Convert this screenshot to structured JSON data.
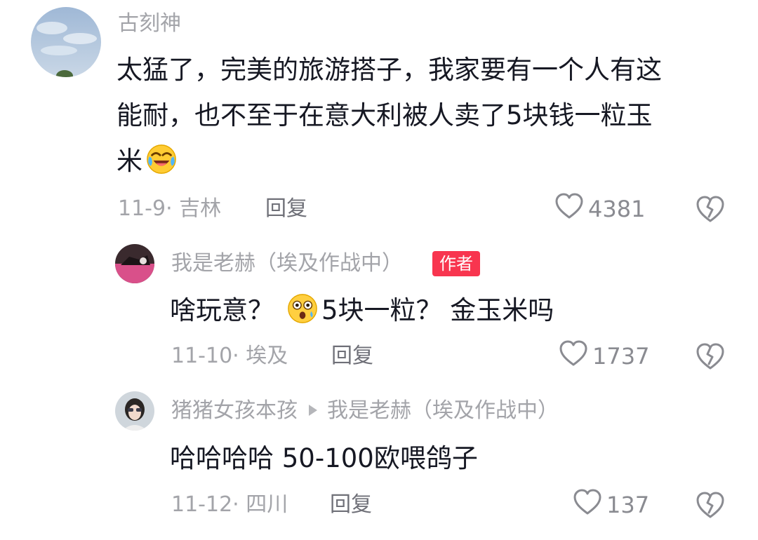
{
  "comments": [
    {
      "username": "古刻神",
      "text_line1": "太猛了，完美的旅游搭子，我家要有一个人有这",
      "text_line2": "能耐，也不至于在意大利被人卖了5块钱一粒玉",
      "text_line3": "米",
      "emoji": "laugh-cry-emoji",
      "date_location": "11-9· 吉林",
      "reply_label": "回复",
      "likes": "4381"
    },
    {
      "username": "我是老赫（埃及作战中）",
      "badge": "作者",
      "text_before_emoji": "啥玩意？",
      "emoji": "shocked-face-emoji",
      "text_after_emoji": "5块一粒？ 金玉米吗",
      "date_location": "11-10· 埃及",
      "reply_label": "回复",
      "likes": "1737"
    },
    {
      "username": "猪猪女孩本孩",
      "reply_to": "我是老赫（埃及作战中）",
      "text": "哈哈哈哈  50-100欧喂鸽子",
      "date_location": "11-12· 四川",
      "reply_label": "回复",
      "likes": "137"
    }
  ],
  "colors": {
    "meta_gray": "#a3a4a9",
    "badge_red": "#f8354f",
    "text_dark": "#161823"
  },
  "icons": [
    "heart-outline-icon",
    "broken-heart-icon",
    "reply-arrow-icon"
  ]
}
